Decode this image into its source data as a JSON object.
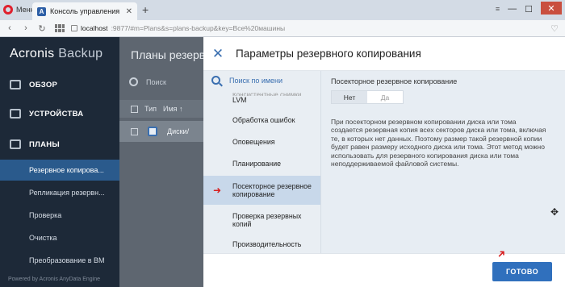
{
  "browser": {
    "menu_label": "Меню",
    "tab_title": "Консоль управления резе",
    "tab_favicon": "A",
    "new_tab": "+",
    "url_host": "localhost",
    "url_rest": ":9877/#m=Plans&s=plans-backup&key=Все%20машины",
    "window_controls": [
      "⧉",
      "—",
      "☐",
      "✕"
    ],
    "filter_icon": "≡"
  },
  "sidebar": {
    "logo_main": "Acronis",
    "logo_thin": " Backup",
    "nav": [
      {
        "label": "ОБЗОР",
        "icon": "dashboard-icon"
      },
      {
        "label": "УСТРОЙСТВА",
        "icon": "devices-icon"
      },
      {
        "label": "ПЛАНЫ",
        "icon": "plans-icon"
      }
    ],
    "subitems": [
      {
        "label": "Резервное копирова...",
        "active": true
      },
      {
        "label": "Репликация резервн..."
      },
      {
        "label": "Проверка"
      },
      {
        "label": "Очистка"
      },
      {
        "label": "Преобразование в ВМ"
      }
    ],
    "footer": "Powered by Acronis AnyData Engine"
  },
  "main": {
    "title": "Планы резервн",
    "search_placeholder": "Поиск",
    "col_type": "Тип",
    "col_name": "Имя ↑",
    "row_name": "Диски/"
  },
  "panel": {
    "close": "✕",
    "title": "Параметры резервного копирования",
    "search_label": "Поиск по имени",
    "items": [
      {
        "label": "LVM",
        "partial_top": "Консистентные снимки"
      },
      {
        "label": "Обработка ошибок"
      },
      {
        "label": "Оповещения"
      },
      {
        "label": "Планирование"
      },
      {
        "label": "Посекторное резервное копирование",
        "active": true
      },
      {
        "label": "Проверка резервных копий"
      },
      {
        "label": "Производительность"
      }
    ],
    "content": {
      "label": "Посекторное резервное копирование",
      "toggle_on": "Нет",
      "toggle_off": "Да",
      "description": "При посекторном резервном копировании диска или тома создается резервная копия всех секторов диска или тома, включая те, в которых нет данных. Поэтому размер такой резервной копии будет равен размеру исходного диска или тома. Этот метод можно использовать для резервного копирования диска или тома неподдерживаемой файловой системы."
    },
    "done_button": "ГОТОВО"
  },
  "colors": {
    "sidebar_bg": "#1d2938",
    "accent": "#3070bd",
    "active_item": "#c8d8ea",
    "annotation_arrow": "#d81f1f"
  }
}
